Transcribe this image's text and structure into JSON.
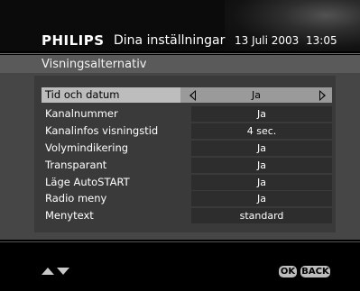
{
  "header": {
    "brand": "PHILIPS",
    "title": "Dina inställningar",
    "date": "13 Juli 2003",
    "time": "13:05"
  },
  "subheader": {
    "title": "Visningsalternativ"
  },
  "options": [
    {
      "label": "Tid och datum",
      "value": "Ja",
      "selected": true
    },
    {
      "label": "Kanalnummer",
      "value": "Ja"
    },
    {
      "label": "Kanalinfos visningstid",
      "value": "4 sec."
    },
    {
      "label": "Volymindikering",
      "value": "Ja"
    },
    {
      "label": "Transparant",
      "value": "Ja"
    },
    {
      "label": "Läge AutoSTART",
      "value": "Ja"
    },
    {
      "label": "Radio meny",
      "value": "Ja"
    },
    {
      "label": "Menytext",
      "value": "standard"
    }
  ],
  "footer": {
    "navigation_icon": "up-down-arrows-icon",
    "ok_label": "OK",
    "back_label": "BACK"
  },
  "colors": {
    "background": "#000000",
    "subheader": "#5a5a5a",
    "panel": "#464646",
    "selected_row": "#bdbdbd",
    "value_box": "#2d2d2d"
  }
}
